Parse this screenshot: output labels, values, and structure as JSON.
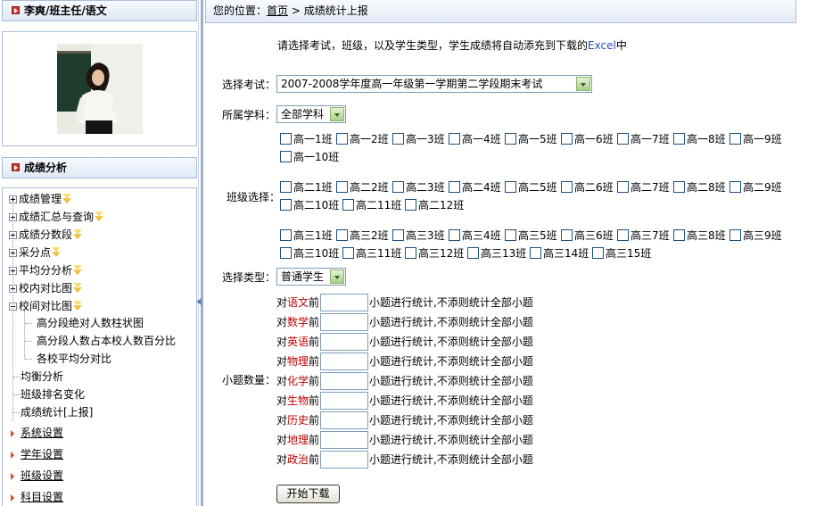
{
  "sidebar": {
    "user_title": "李爽/班主任/语文",
    "analysis_title": "成绩分析",
    "tree": [
      {
        "label": "成绩管理",
        "badge": true,
        "expanded": false
      },
      {
        "label": "成绩汇总与查询",
        "badge": true,
        "expanded": false
      },
      {
        "label": "成绩分数段",
        "badge": true,
        "expanded": false
      },
      {
        "label": "采分点",
        "badge": true,
        "expanded": false
      },
      {
        "label": "平均分分析",
        "badge": true,
        "expanded": false
      },
      {
        "label": "校内对比图",
        "badge": true,
        "expanded": false
      },
      {
        "label": "校间对比图",
        "badge": true,
        "expanded": true
      }
    ],
    "subtree": [
      "高分段绝对人数柱状图",
      "高分段人数占本校人数百分比",
      "各校平均分对比"
    ],
    "leaves": [
      "均衡分析",
      "班级排名变化",
      "成绩统计[上报]"
    ],
    "menu": [
      "系统设置",
      "学年设置",
      "班级设置",
      "科目设置"
    ]
  },
  "breadcrumb": {
    "prefix": "您的位置：",
    "home": "首页",
    "separator": ">",
    "current": "成绩统计上报"
  },
  "intro": {
    "text": "请选择考试，班级，以及学生类型，学生成绩将自动添充到下载的",
    "excel": "Excel",
    "suffix": "中"
  },
  "form": {
    "exam_label": "选择考试：",
    "exam_value": "2007-2008学年度高一年级第一学期第二学段期末考试",
    "subject_label": "所属学科：",
    "subject_value": "全部学科",
    "class_label": "班级选择：",
    "grade1": [
      "高一1班",
      "高一2班",
      "高一3班",
      "高一4班",
      "高一5班",
      "高一6班",
      "高一7班",
      "高一8班",
      "高一9班",
      "高一10班"
    ],
    "grade2": [
      "高二1班",
      "高二2班",
      "高二3班",
      "高二4班",
      "高二5班",
      "高二6班",
      "高二7班",
      "高二8班",
      "高二9班",
      "高二10班",
      "高二11班",
      "高二12班"
    ],
    "grade3": [
      "高三1班",
      "高三2班",
      "高三3班",
      "高三4班",
      "高三5班",
      "高三6班",
      "高三7班",
      "高三8班",
      "高三9班",
      "高三10班",
      "高三11班",
      "高三12班",
      "高三13班",
      "高三14班",
      "高三15班"
    ],
    "type_label": "选择类型：",
    "type_value": "普通学生",
    "question_label": "小题数量：",
    "question_prefix": "对",
    "question_before": "前",
    "question_suffix": "小题进行统计,不添则统计全部小题",
    "subjects": [
      "语文",
      "数学",
      "英语",
      "物理",
      "化学",
      "生物",
      "历史",
      "地理",
      "政治"
    ],
    "start_button": "开始下载"
  }
}
